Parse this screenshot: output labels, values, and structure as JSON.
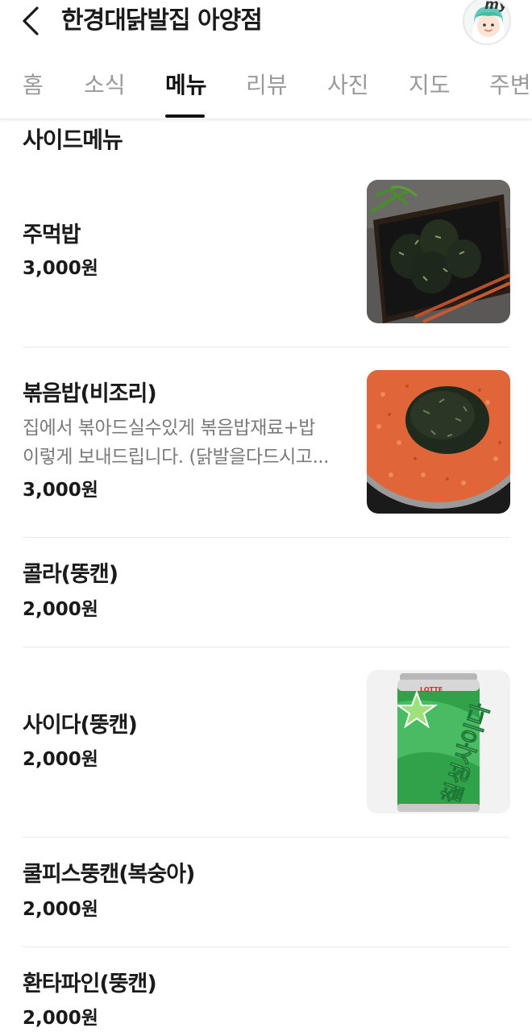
{
  "header": {
    "title": "한경대닭발집 아양점",
    "avatar_tag": "my"
  },
  "tabs": [
    {
      "label": "홈"
    },
    {
      "label": "소식"
    },
    {
      "label": "메뉴",
      "active": true
    },
    {
      "label": "리뷰"
    },
    {
      "label": "사진"
    },
    {
      "label": "지도"
    },
    {
      "label": "주변"
    }
  ],
  "section": {
    "title": "사이드메뉴"
  },
  "menu": [
    {
      "name": "주먹밥",
      "price": "3,000원",
      "image": "rice-ball-photo"
    },
    {
      "name": "볶음밥(비조리)",
      "desc1": "집에서 볶아드실수있게 볶음밥재료+밥",
      "desc2": "이렇게 보내드립니다. (닭발을다드시고...",
      "price": "3,000원",
      "image": "fried-rice-photo"
    },
    {
      "name": "콜라(뚱캔)",
      "price": "2,000원"
    },
    {
      "name": "사이다(뚱캔)",
      "price": "2,000원",
      "image": "cider-can-photo",
      "can_brand": "LOTTE",
      "can_text": "칠성사이다"
    },
    {
      "name": "쿨피스뚱캔(복숭아)",
      "price": "2,000원"
    },
    {
      "name": "환타파인(뚱캔)",
      "price": "2,000원"
    }
  ],
  "colors": {
    "active_tab": "#111111",
    "inactive_tab": "#9a9a9a",
    "desc": "#7a7a7a",
    "divider": "#ececec"
  }
}
